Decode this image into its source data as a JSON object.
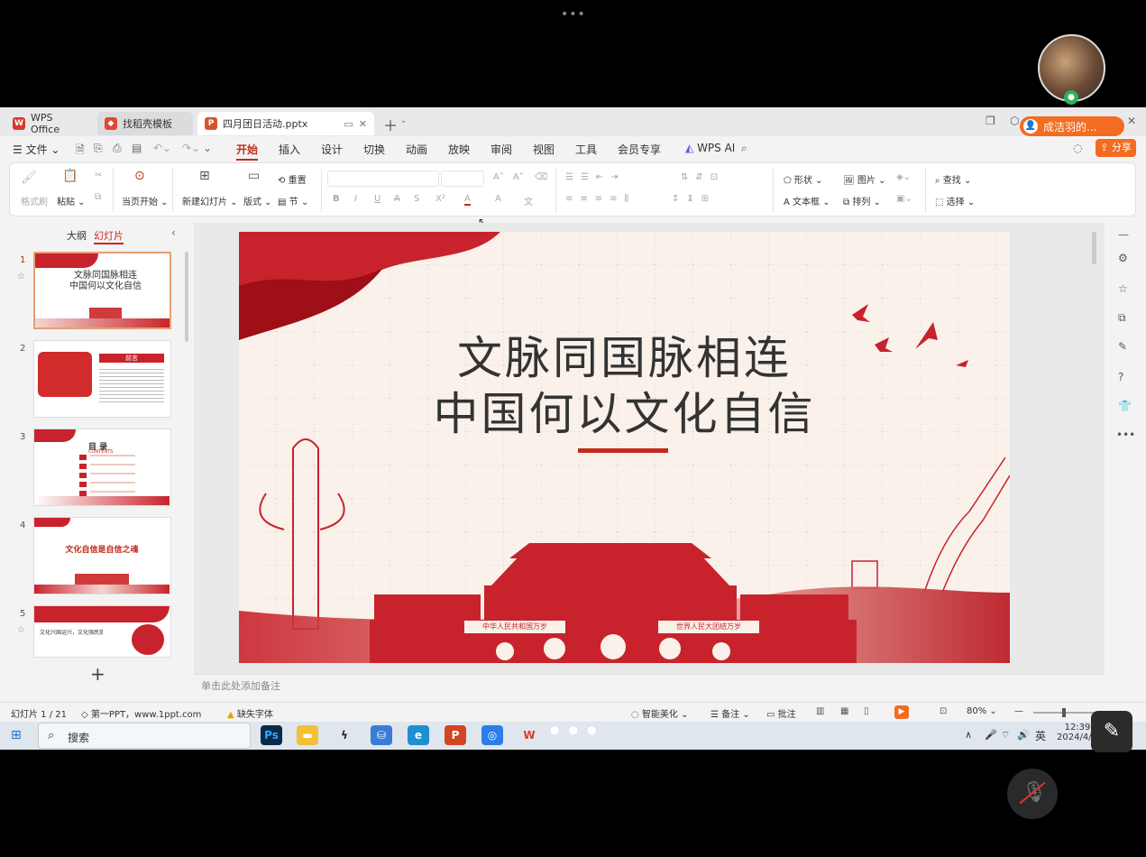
{
  "meeting": {
    "participant_name": "成洁羽的...",
    "more_dots": "•••"
  },
  "tabs": [
    {
      "label": "WPS Office"
    },
    {
      "label": "找稻壳模板"
    },
    {
      "label": "四月团日活动.pptx"
    }
  ],
  "menu": {
    "file": "文件",
    "items": [
      "开始",
      "插入",
      "设计",
      "切换",
      "动画",
      "放映",
      "审阅",
      "视图",
      "工具",
      "会员专享"
    ],
    "wps_ai": "WPS AI",
    "share": "分享"
  },
  "ribbon": {
    "format_painter": "格式刷",
    "paste": "粘贴",
    "from_current": "当页开始",
    "new_slide": "新建幻灯片",
    "layout": "版式",
    "reset": "重置",
    "section": "节",
    "shape": "形状",
    "picture": "图片",
    "textbox": "文本框",
    "arrange": "排列",
    "find": "查找",
    "select": "选择",
    "font_btns": [
      "B",
      "I",
      "U",
      "A",
      "S",
      "X²",
      "A",
      "A",
      "文"
    ]
  },
  "left": {
    "outline": "大纲",
    "slides": "幻灯片",
    "add": "+",
    "thumbs": [
      {
        "num": "1",
        "title1": "文脉同国脉相连",
        "title2": "中国何以文化自信"
      },
      {
        "num": "2",
        "title": "前言"
      },
      {
        "num": "3",
        "title": "目 录",
        "sub": "CONTENTS"
      },
      {
        "num": "4",
        "title": "文化自信是自信之魂"
      },
      {
        "num": "5",
        "title": "文化兴国运兴，文化强民族强"
      }
    ]
  },
  "slide": {
    "title1": "文脉同国脉相连",
    "title2": "中国何以文化自信",
    "banner_left": "中华人民共和国万岁",
    "banner_right": "世界人民大团结万岁"
  },
  "notes_placeholder": "单击此处添加备注",
  "status": {
    "slide_count": "幻灯片 1 / 21",
    "theme": "第一PPT，www.1ppt.com",
    "missing_font": "缺失字体",
    "smart": "智能美化",
    "notes": "备注",
    "comment": "批注",
    "zoom": "80%"
  },
  "taskbar": {
    "search": "搜索",
    "time": "12:39",
    "date": "2024/4/24",
    "lang": "英"
  },
  "colors": {
    "accent": "#c42b1c",
    "wps_red": "#d43b2a",
    "share_orange": "#f36c21"
  }
}
